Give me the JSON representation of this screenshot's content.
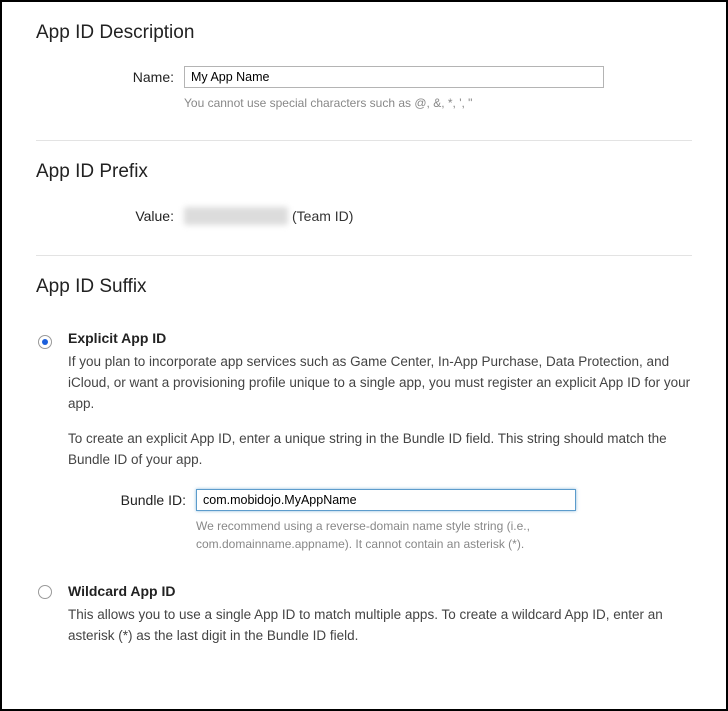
{
  "description": {
    "title": "App ID Description",
    "name_label": "Name:",
    "name_value": "My App Name",
    "name_hint": "You cannot use special characters such as @, &, *, ', \""
  },
  "prefix": {
    "title": "App ID Prefix",
    "value_label": "Value:",
    "team_id_suffix": "(Team ID)"
  },
  "suffix": {
    "title": "App ID Suffix",
    "explicit": {
      "title": "Explicit App ID",
      "desc1": "If you plan to incorporate app services such as Game Center, In-App Purchase, Data Protection, and iCloud, or want a provisioning profile unique to a single app, you must register an explicit App ID for your app.",
      "desc2": "To create an explicit App ID, enter a unique string in the Bundle ID field. This string should match the Bundle ID of your app.",
      "bundle_label": "Bundle ID:",
      "bundle_value": "com.mobidojo.MyAppName",
      "bundle_hint": "We recommend using a reverse-domain name style string (i.e., com.domainname.appname). It cannot contain an asterisk (*)."
    },
    "wildcard": {
      "title": "Wildcard App ID",
      "desc": "This allows you to use a single App ID to match multiple apps. To create a wildcard App ID, enter an asterisk (*) as the last digit in the Bundle ID field."
    }
  }
}
